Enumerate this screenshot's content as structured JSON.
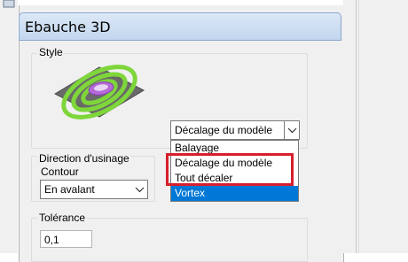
{
  "panel": {
    "title": "Ebauche 3D"
  },
  "style_group": {
    "label": "Style",
    "preview_icon": "toolpath-preview-icon",
    "combo_value": "Décalage du modèle",
    "dropdown_options": [
      {
        "label": "Balayage"
      },
      {
        "label": "Décalage du modèle"
      },
      {
        "label": "Tout décaler"
      },
      {
        "label": "Vortex"
      }
    ],
    "highlight_color": "#d81e2c",
    "selected_color": "#0078d7"
  },
  "direction_group": {
    "label": "Direction d'usinage",
    "sublabel": "Contour",
    "combo_value": "En avalant"
  },
  "tolerance_group": {
    "label": "Tolérance",
    "value": "0,1"
  }
}
